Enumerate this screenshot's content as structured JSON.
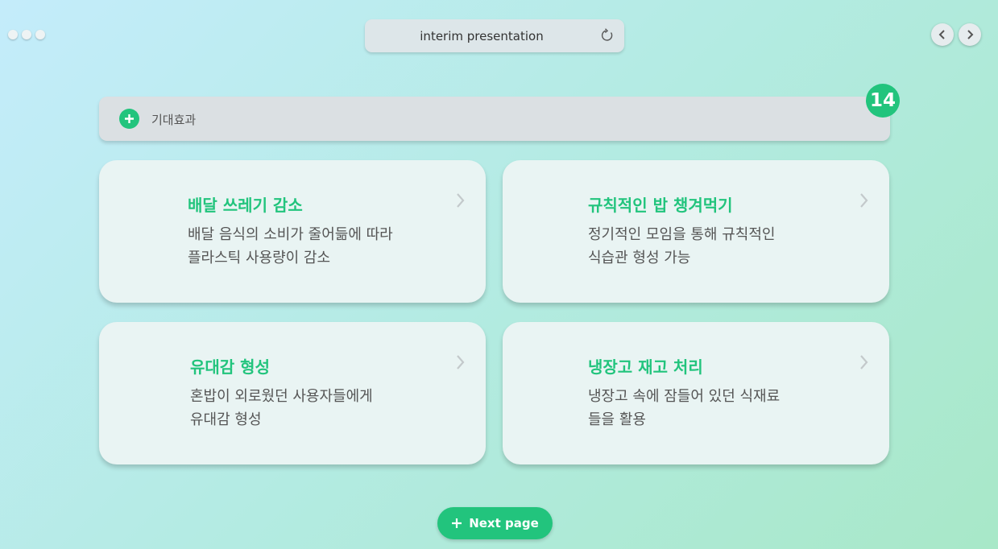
{
  "window": {
    "title": "interim presentation"
  },
  "section": {
    "label": "기대효과",
    "page_number": "14"
  },
  "cards": [
    {
      "title": "배달 쓰레기 감소",
      "line1": "배달 음식의 소비가 줄어듦에 따라",
      "line2": "플라스틱 사용량이 감소"
    },
    {
      "title": "규칙적인 밥 챙겨먹기",
      "line1": "정기적인 모임을 통해 규칙적인",
      "line2": "식습관 형성 가능"
    },
    {
      "title": "유대감 형성",
      "line1": "혼밥이 외로웠던 사용자들에게",
      "line2": "유대감 형성"
    },
    {
      "title": "냉장고 재고 처리",
      "line1": "냉장고 속에 잠들어 있던 식재료",
      "line2": "들을 활용"
    }
  ],
  "next_button": {
    "label": "Next page"
  },
  "colors": {
    "accent": "#22c47d",
    "card_bg": "#e9f4f3"
  }
}
